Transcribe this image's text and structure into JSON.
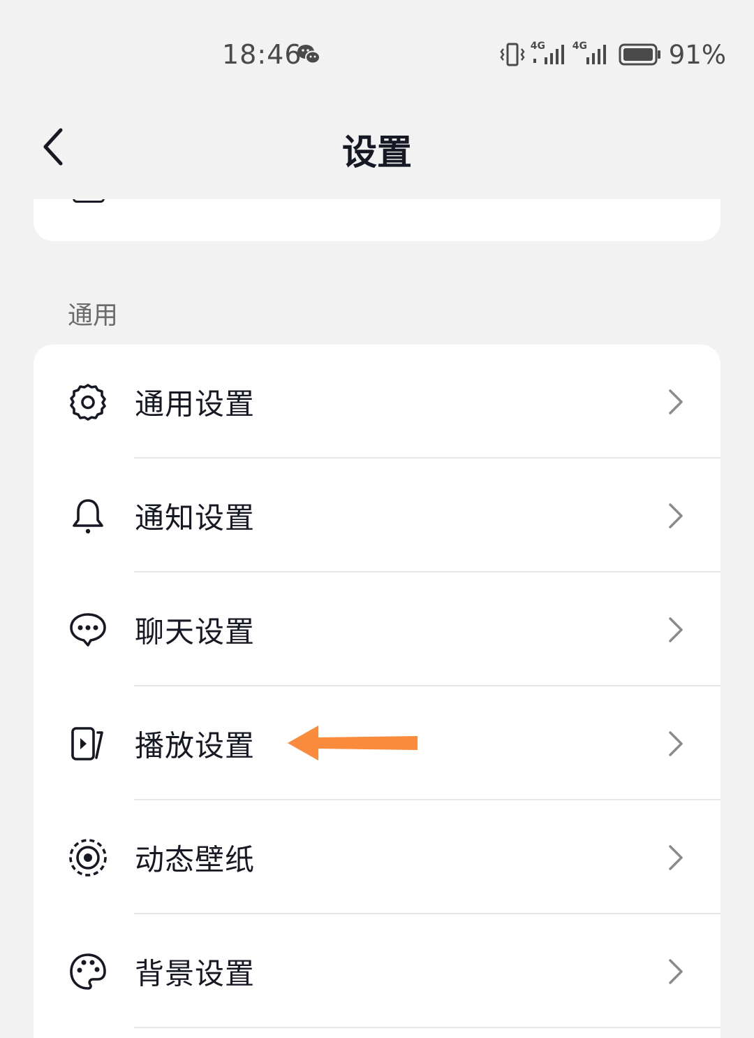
{
  "status_bar": {
    "time": "18:46",
    "network_1": "4G",
    "network_2": "4G",
    "battery_percent": "91%"
  },
  "nav": {
    "title": "设置"
  },
  "section": {
    "title": "通用"
  },
  "settings_items": [
    {
      "label": "通用设置",
      "icon": "gear-icon"
    },
    {
      "label": "通知设置",
      "icon": "bell-icon"
    },
    {
      "label": "聊天设置",
      "icon": "chat-bubble-icon"
    },
    {
      "label": "播放设置",
      "icon": "play-screen-icon"
    },
    {
      "label": "动态壁纸",
      "icon": "live-wallpaper-icon"
    },
    {
      "label": "背景设置",
      "icon": "palette-icon"
    }
  ],
  "colors": {
    "background": "#f2f2f2",
    "card": "#ffffff",
    "text_primary": "#161823",
    "text_secondary": "#6b6b6b",
    "chevron": "#8a8a8a",
    "divider": "#e6e6e6",
    "annotation_arrow": "#fb8b3c"
  }
}
